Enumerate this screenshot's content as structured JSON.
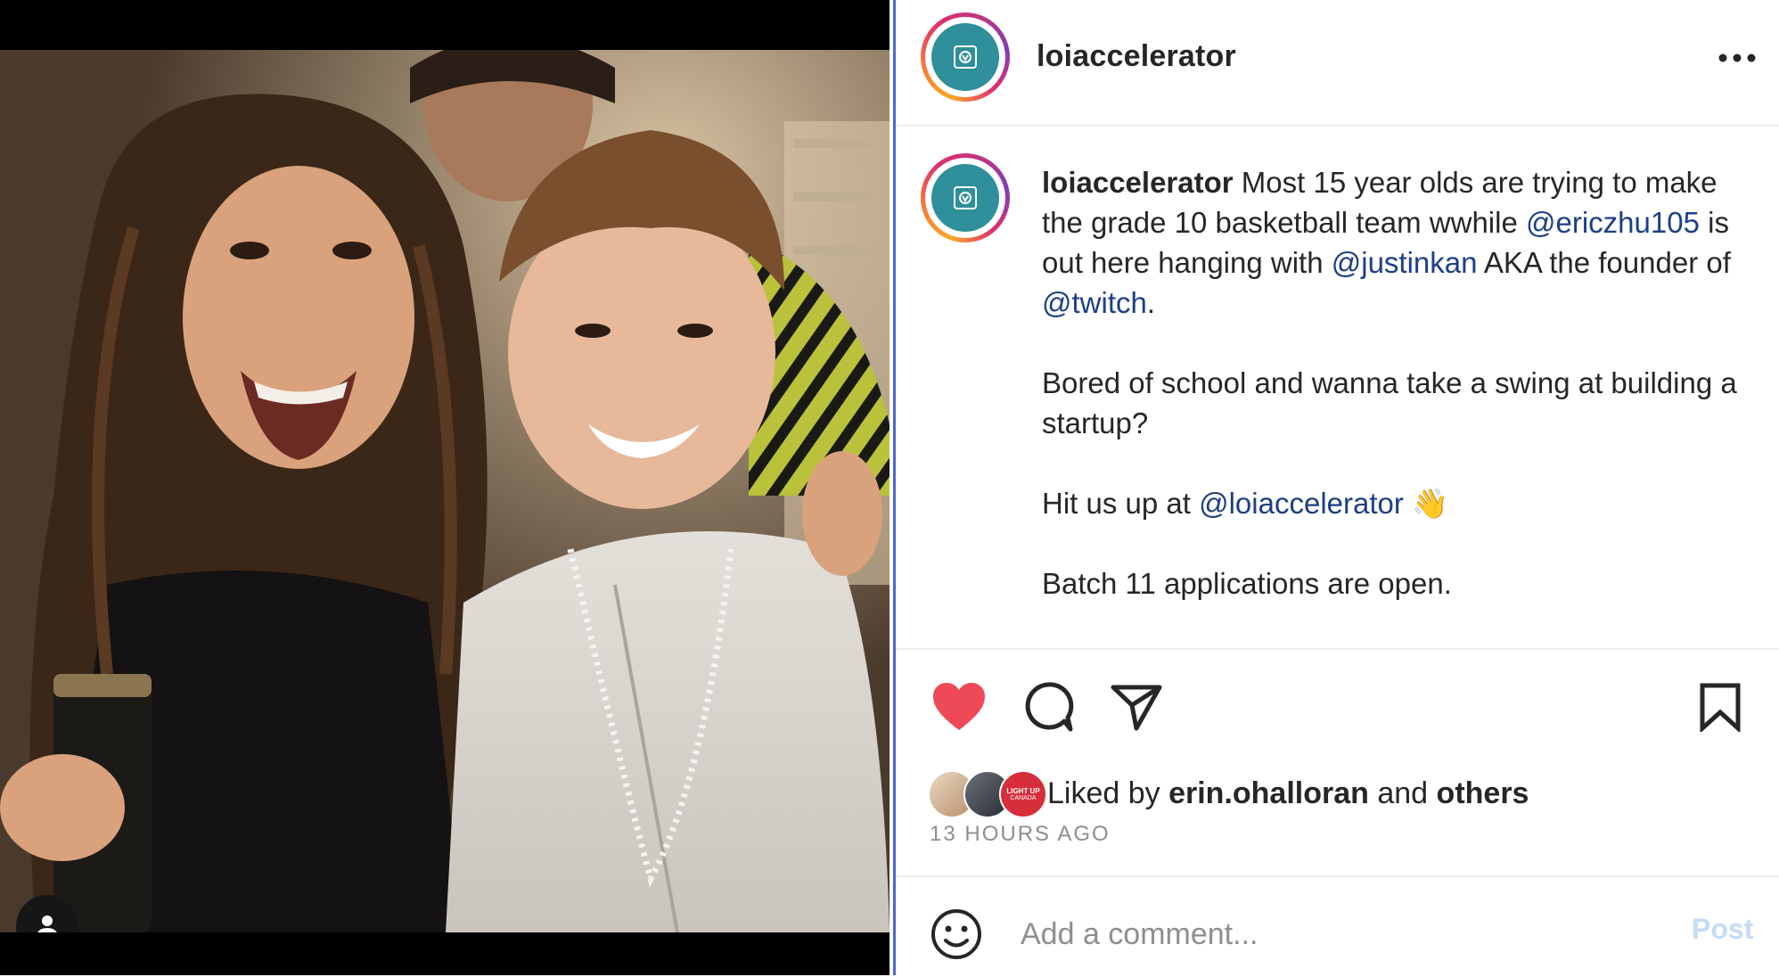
{
  "photo": {
    "alt": "Two people smiling at a party",
    "tag_icon": "user-tag-icon"
  },
  "header": {
    "username": "loiaccelerator",
    "more_icon": "more-horizontal-icon"
  },
  "caption": {
    "username": "loiaccelerator",
    "line1_rest": " Most 15 year olds are trying to make the grade 10 basketball team wwhile ",
    "mention1": "@ericzhu105",
    "mid1": " is out here hanging with ",
    "mention2": "@justinkan",
    "mid2": " AKA the founder of ",
    "mention3": "@twitch",
    "end1": ".",
    "para2": "Bored of school and wanna take a swing at building a startup?",
    "para3_text": "Hit us up at ",
    "mention4": "@loiaccelerator",
    "para3_emoji": "👋",
    "para4": "Batch 11 applications are open."
  },
  "actions": {
    "like_icon": "heart-filled-icon",
    "comment_icon": "comment-icon",
    "share_icon": "send-icon",
    "save_icon": "bookmark-icon",
    "like_color": "#ed4956"
  },
  "likes": {
    "prefix": "Liked by ",
    "user": "erin.ohalloran",
    "middle": " and ",
    "others": "others",
    "badge_text_1": "LIGHT UP",
    "badge_text_2": "CANADA"
  },
  "timestamp": "13 HOURS AGO",
  "comment": {
    "placeholder": "Add a comment...",
    "post_label": "Post",
    "emoji_icon": "smiley-icon"
  }
}
